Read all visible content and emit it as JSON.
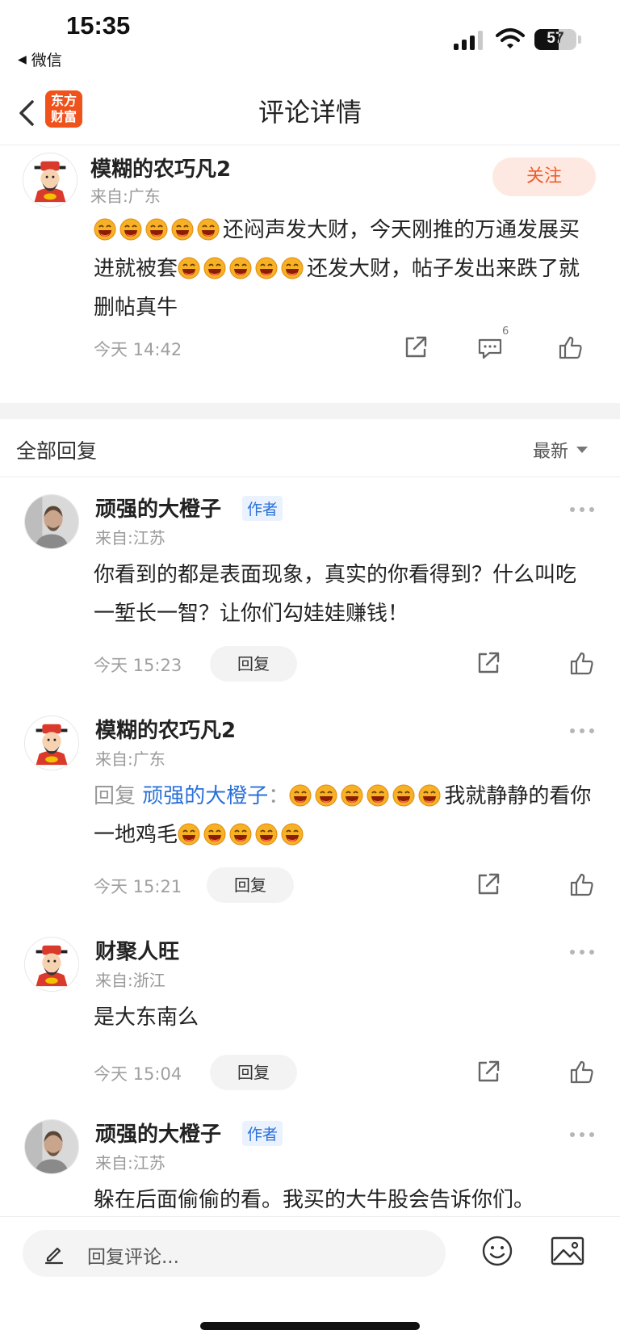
{
  "status_bar": {
    "time": "15:35",
    "back_app": "微信",
    "battery": "57",
    "battery_level": 0.57
  },
  "nav": {
    "title": "评论详情",
    "logo_text": "东方财富"
  },
  "main_comment": {
    "user": "模糊的农巧凡2",
    "location": "来自:广东",
    "follow_label": "关注",
    "text_part1": "还闷声发大财，今天刚推的万通发展买进就被套",
    "text_part2": "还发大财，帖子发出来跌了就删帖真牛",
    "time": "今天 14:42",
    "comment_count": "6"
  },
  "replies_header": {
    "title": "全部回复",
    "sort": "最新"
  },
  "replies": [
    {
      "user": "顽强的大橙子",
      "badge": "作者",
      "location": "来自:江苏",
      "text": "你看到的都是表面现象，真实的你看得到？什么叫吃一堑长一智？让你们勾娃娃赚钱！",
      "time": "今天 15:23",
      "reply_label": "回复"
    },
    {
      "user": "模糊的农巧凡2",
      "location": "来自:广东",
      "reply_prefix": "回复",
      "mention": "顽强的大橙子",
      "colon": "：",
      "text_part1": "我就静静的看你一地鸡毛",
      "time": "今天 15:21",
      "reply_label": "回复"
    },
    {
      "user": "财聚人旺",
      "location": "来自:浙江",
      "text": "是大东南么",
      "time": "今天 15:04",
      "reply_label": "回复"
    },
    {
      "user": "顽强的大橙子",
      "badge": "作者",
      "location": "来自:江苏",
      "text": "躲在后面偷偷的看。我买的大牛股会告诉你们。"
    }
  ],
  "bottom_bar": {
    "placeholder": "回复评论..."
  },
  "icons": [
    "back-icon",
    "share-icon",
    "comment-icon",
    "like-icon",
    "more-icon",
    "pen-icon",
    "emoji-icon",
    "image-icon"
  ],
  "colors": {
    "accent": "#f25b2a",
    "link": "#2a70d8",
    "logo_bg": "#f0521c"
  }
}
